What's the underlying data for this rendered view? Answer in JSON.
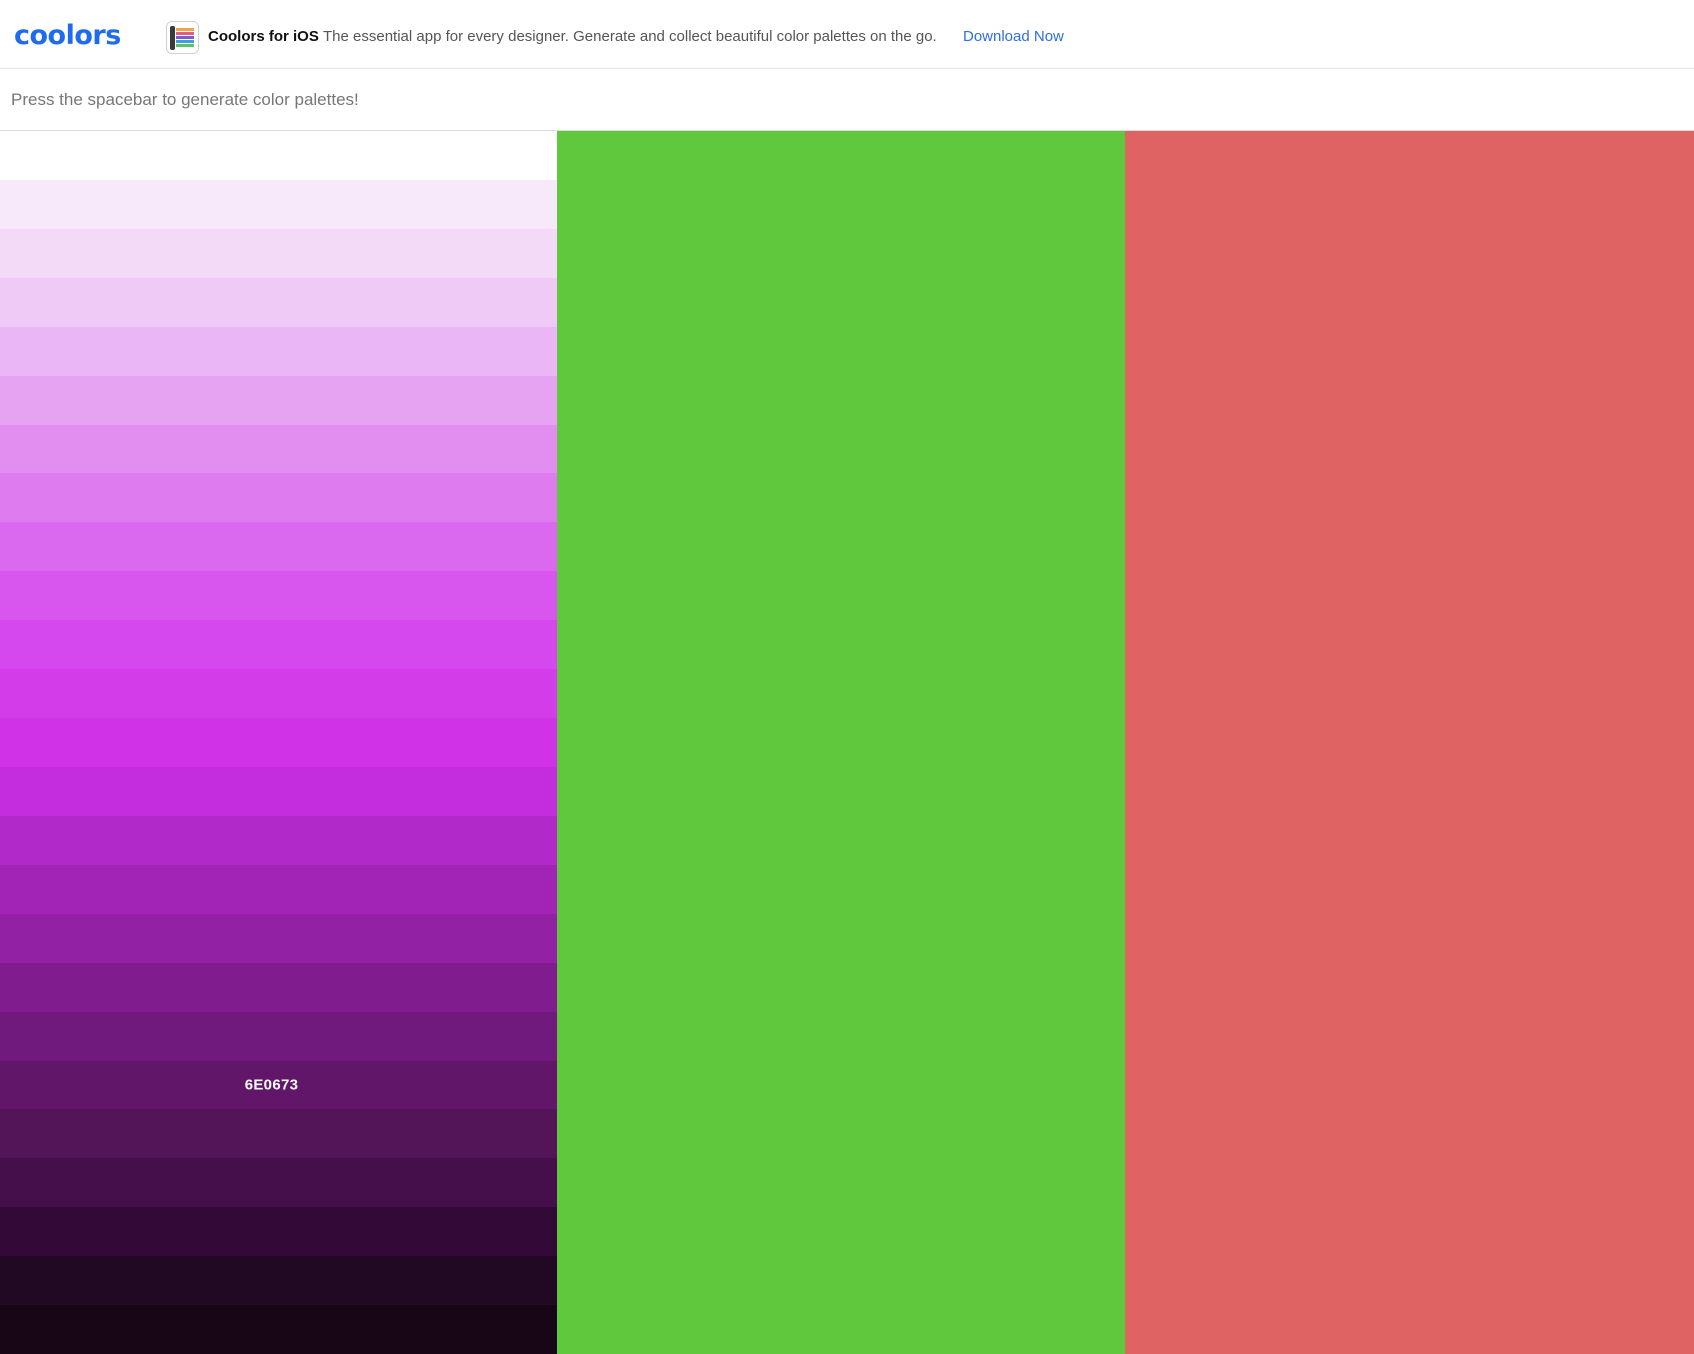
{
  "header": {
    "logo_text": "coolors",
    "app_icon": "ios-app-icon",
    "promo_title": "Coolors for iOS",
    "promo_text": "The essential app for every designer. Generate and collect beautiful color palettes on the go.",
    "promo_link": "Download Now",
    "brand_color": "#1f6bf0",
    "link_color": "#2f6fdc"
  },
  "hint": {
    "text": "Press the spacebar to generate color palettes!"
  },
  "palette": {
    "columns": [
      {
        "type": "shades",
        "active_hex": "6E0673",
        "shades": [
          "#ffffff",
          "#f8e9fa",
          "#f3dbf8",
          "#efcaf7",
          "#ebb6f5",
          "#e6a3f2",
          "#e28ef0",
          "#de7cef",
          "#db69ef",
          "#d856ee",
          "#d548ed",
          "#d33ce9",
          "#d032e8",
          "#c32dde",
          "#b129c9",
          "#a224b6",
          "#9321a3",
          "#811c8e",
          "#701a7e",
          "#621669",
          "#541458",
          "#450f4b",
          "#330a37",
          "#210823",
          "#180516"
        ],
        "active_index": 19
      },
      {
        "type": "solid",
        "color": "#60c83c"
      },
      {
        "type": "solid",
        "color": "#e06363"
      }
    ]
  }
}
